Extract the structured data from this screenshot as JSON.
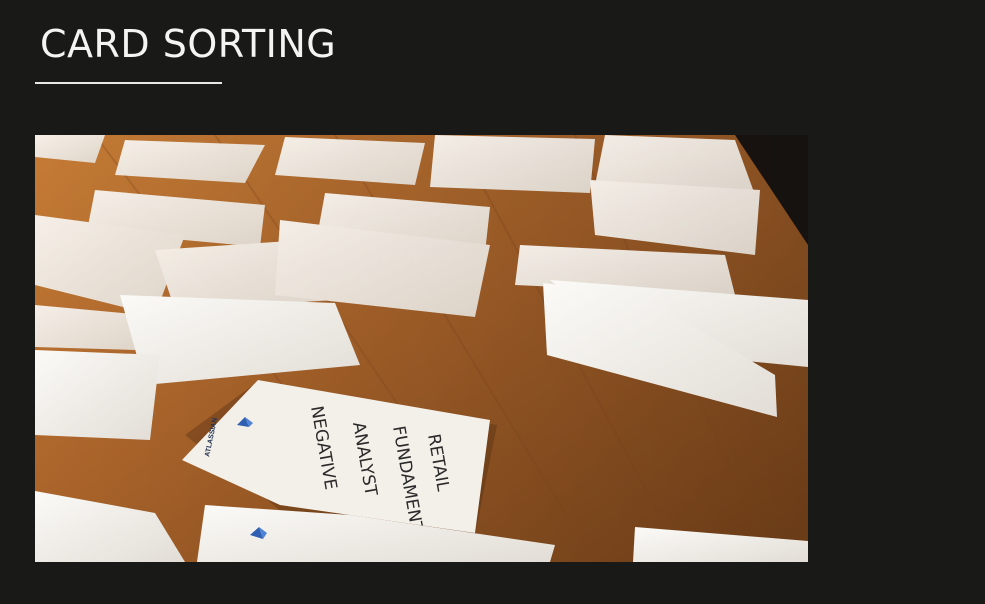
{
  "header": {
    "title": "CARD SORTING"
  },
  "photo": {
    "subject": "sticky-cards-on-wooden-table",
    "card": {
      "lines": [
        "RETAIL",
        "FUNDAMENTAL",
        "ANALYST",
        "NEGATIVE"
      ],
      "brand": "ATLASSIAN"
    }
  },
  "colors": {
    "background": "#191918",
    "title_text": "#f4f4f2",
    "underline": "#e8e8e6",
    "wood": "#a86326",
    "card": "#f2efea"
  }
}
